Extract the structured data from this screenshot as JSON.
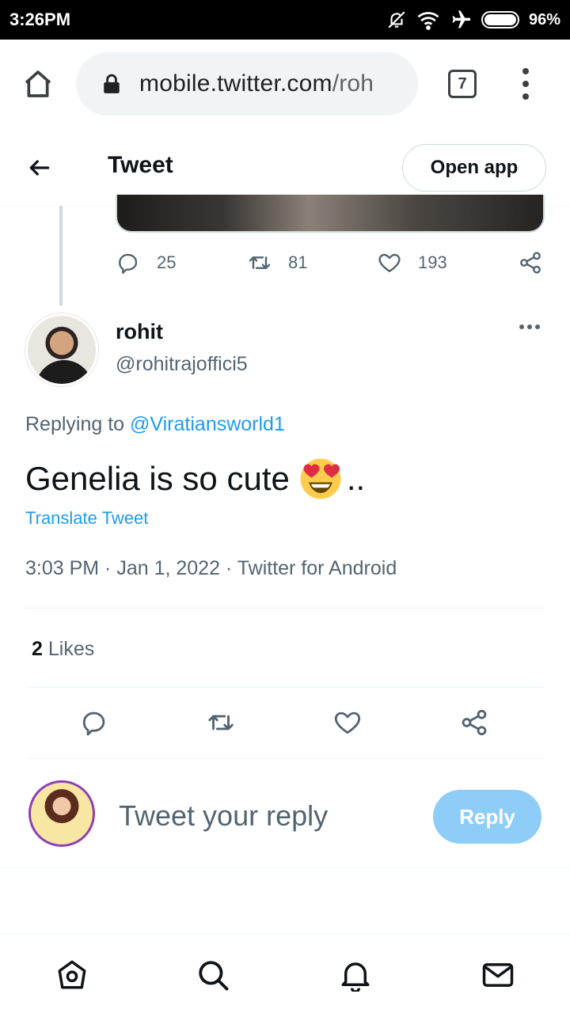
{
  "status_bar": {
    "time": "3:26PM",
    "battery": "96%"
  },
  "browser": {
    "url_host": "mobile.twitter.com",
    "url_path": "/roh",
    "tab_count": "7"
  },
  "header": {
    "title": "Tweet",
    "open_app_label": "Open app"
  },
  "previous_tweet": {
    "replies": "25",
    "retweets": "81",
    "likes": "193"
  },
  "tweet": {
    "name": "rohit",
    "handle": "@rohitrajoffici5",
    "replying_label": "Replying to",
    "replying_to": "@Viratiansworld1",
    "text_before": "Genelia is so cute",
    "text_after": "..",
    "translate_label": "Translate Tweet",
    "meta": "3:03 PM · Jan 1, 2022 · Twitter for Android",
    "likes_count": "2",
    "likes_label": "Likes"
  },
  "composer": {
    "placeholder": "Tweet your reply",
    "reply_label": "Reply"
  },
  "colors": {
    "accent": "#1d9bf0",
    "reply_disabled": "#8ecdf8",
    "secondary_text": "#536471"
  },
  "icons": {
    "status": [
      "mute-icon",
      "wifi-icon",
      "airplane-icon",
      "battery-icon"
    ],
    "bottom_nav": [
      "home-icon",
      "search-icon",
      "notifications-icon",
      "messages-icon"
    ]
  }
}
